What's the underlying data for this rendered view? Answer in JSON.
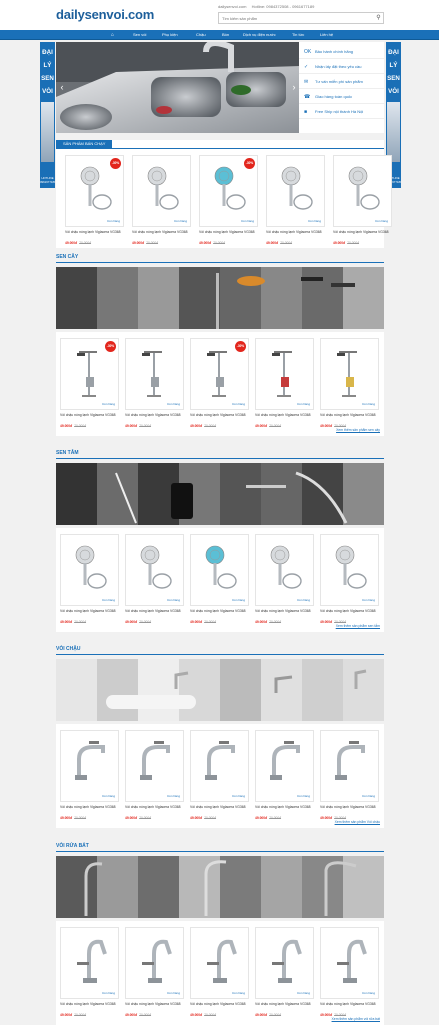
{
  "header": {
    "logo": "dailysenvoi.com",
    "site": "dailysenvoi.com",
    "hotline": "Hotline: 0984372508 - 0961677189",
    "search_placeholder": "Tìm kiếm sản phẩm"
  },
  "nav": {
    "items": [
      "Sen vòi",
      "Phụ kiện",
      "Chậu",
      "Bồn",
      "Dịch vụ điện nước",
      "Tin tức",
      "Liên hệ"
    ]
  },
  "side_banner": {
    "lines": [
      "ĐẠI",
      "LÝ",
      "SEN",
      "VÒI"
    ],
    "hotline": "HOTLINE",
    "phone": "0961677189"
  },
  "policy": [
    {
      "icon": "ok-icon",
      "label": "Bảo hành chính hãng"
    },
    {
      "icon": "gift-icon",
      "label": "Nhận lấy đặt theo yêu cầu"
    },
    {
      "icon": "chat-icon",
      "label": "Tư vấn miễn phí sản phẩm"
    },
    {
      "icon": "ship-icon",
      "label": "Giao hàng toàn quốc"
    },
    {
      "icon": "truck-icon",
      "label": "Free Ship nội thành Hà Nội"
    }
  ],
  "best": {
    "tab": "SẢN PHẨM BÁN CHẠY",
    "products": [
      {
        "name": "Vòi chậu nóng lạnh Viglacera VG368",
        "price": "49.000đ",
        "old": "70.000đ",
        "badge": "-30%",
        "stock": "Còn hàng"
      },
      {
        "name": "Vòi chậu nóng lạnh Viglacera VG368",
        "price": "49.000đ",
        "old": "70.000đ",
        "badge": "",
        "stock": "Còn hàng"
      },
      {
        "name": "Vòi chậu nóng lạnh Viglacera VG368",
        "price": "49.000đ",
        "old": "70.000đ",
        "badge": "-30%",
        "stock": "Còn hàng"
      },
      {
        "name": "Vòi chậu nóng lạnh Viglacera VG368",
        "price": "49.000đ",
        "old": "70.000đ",
        "badge": "",
        "stock": "Còn hàng"
      },
      {
        "name": "Vòi chậu nóng lạnh Viglacera VG368",
        "price": "49.000đ",
        "old": "70.000đ",
        "badge": "",
        "stock": "Còn hàng"
      }
    ]
  },
  "sections": [
    {
      "title": "SEN CÂY",
      "more": "Xem thêm sản phẩm sen cây",
      "products": [
        {
          "name": "Vòi chậu nóng lạnh Viglacera VG368",
          "price": "49.000đ",
          "old": "70.000đ",
          "badge": "-30%",
          "stock": "Còn hàng"
        },
        {
          "name": "Vòi chậu nóng lạnh Viglacera VG368",
          "price": "49.000đ",
          "old": "70.000đ",
          "badge": "",
          "stock": "Còn hàng"
        },
        {
          "name": "Vòi chậu nóng lạnh Viglacera VG368",
          "price": "49.000đ",
          "old": "70.000đ",
          "badge": "-30%",
          "stock": "Còn hàng"
        },
        {
          "name": "Vòi chậu nóng lạnh Viglacera VG368",
          "price": "49.000đ",
          "old": "70.000đ",
          "badge": "",
          "stock": "Còn hàng"
        },
        {
          "name": "Vòi chậu nóng lạnh Viglacera VG368",
          "price": "49.000đ",
          "old": "70.000đ",
          "badge": "",
          "stock": "Còn hàng"
        }
      ]
    },
    {
      "title": "SEN TẮM",
      "more": "Xem thêm sản phẩm sen tắm",
      "products": [
        {
          "name": "Vòi chậu nóng lạnh Viglacera VG368",
          "price": "49.000đ",
          "old": "70.000đ",
          "badge": "",
          "stock": "Còn hàng"
        },
        {
          "name": "Vòi chậu nóng lạnh Viglacera VG368",
          "price": "49.000đ",
          "old": "70.000đ",
          "badge": "",
          "stock": "Còn hàng"
        },
        {
          "name": "Vòi chậu nóng lạnh Viglacera VG368",
          "price": "49.000đ",
          "old": "70.000đ",
          "badge": "",
          "stock": "Còn hàng"
        },
        {
          "name": "Vòi chậu nóng lạnh Viglacera VG368",
          "price": "49.000đ",
          "old": "70.000đ",
          "badge": "",
          "stock": "Còn hàng"
        },
        {
          "name": "Vòi chậu nóng lạnh Viglacera VG368",
          "price": "49.000đ",
          "old": "70.000đ",
          "badge": "",
          "stock": "Còn hàng"
        }
      ]
    },
    {
      "title": "VÒI CHẬU",
      "more": "Xem thêm sản phẩm Vòi chậu",
      "products": [
        {
          "name": "Vòi chậu nóng lạnh Viglacera VG368",
          "price": "49.000đ",
          "old": "70.000đ",
          "badge": "",
          "stock": "Còn hàng"
        },
        {
          "name": "Vòi chậu nóng lạnh Viglacera VG368",
          "price": "49.000đ",
          "old": "70.000đ",
          "badge": "",
          "stock": "Còn hàng"
        },
        {
          "name": "Vòi chậu nóng lạnh Viglacera VG368",
          "price": "49.000đ",
          "old": "70.000đ",
          "badge": "",
          "stock": "Còn hàng"
        },
        {
          "name": "Vòi chậu nóng lạnh Viglacera VG368",
          "price": "49.000đ",
          "old": "70.000đ",
          "badge": "",
          "stock": "Còn hàng"
        },
        {
          "name": "Vòi chậu nóng lạnh Viglacera VG368",
          "price": "49.000đ",
          "old": "70.000đ",
          "badge": "",
          "stock": "Còn hàng"
        }
      ]
    },
    {
      "title": "VÒI RỬA BÁT",
      "more": "Xem thêm sản phẩm vòi rửa bát",
      "products": [
        {
          "name": "Vòi chậu nóng lạnh Viglacera VG368",
          "price": "49.000đ",
          "old": "70.000đ",
          "badge": "",
          "stock": "Còn hàng"
        },
        {
          "name": "Vòi chậu nóng lạnh Viglacera VG368",
          "price": "49.000đ",
          "old": "70.000đ",
          "badge": "",
          "stock": "Còn hàng"
        },
        {
          "name": "Vòi chậu nóng lạnh Viglacera VG368",
          "price": "49.000đ",
          "old": "70.000đ",
          "badge": "",
          "stock": "Còn hàng"
        },
        {
          "name": "Vòi chậu nóng lạnh Viglacera VG368",
          "price": "49.000đ",
          "old": "70.000đ",
          "badge": "",
          "stock": "Còn hàng"
        },
        {
          "name": "Vòi chậu nóng lạnh Viglacera VG368",
          "price": "49.000đ",
          "old": "70.000đ",
          "badge": "",
          "stock": "Còn hàng"
        }
      ]
    }
  ]
}
